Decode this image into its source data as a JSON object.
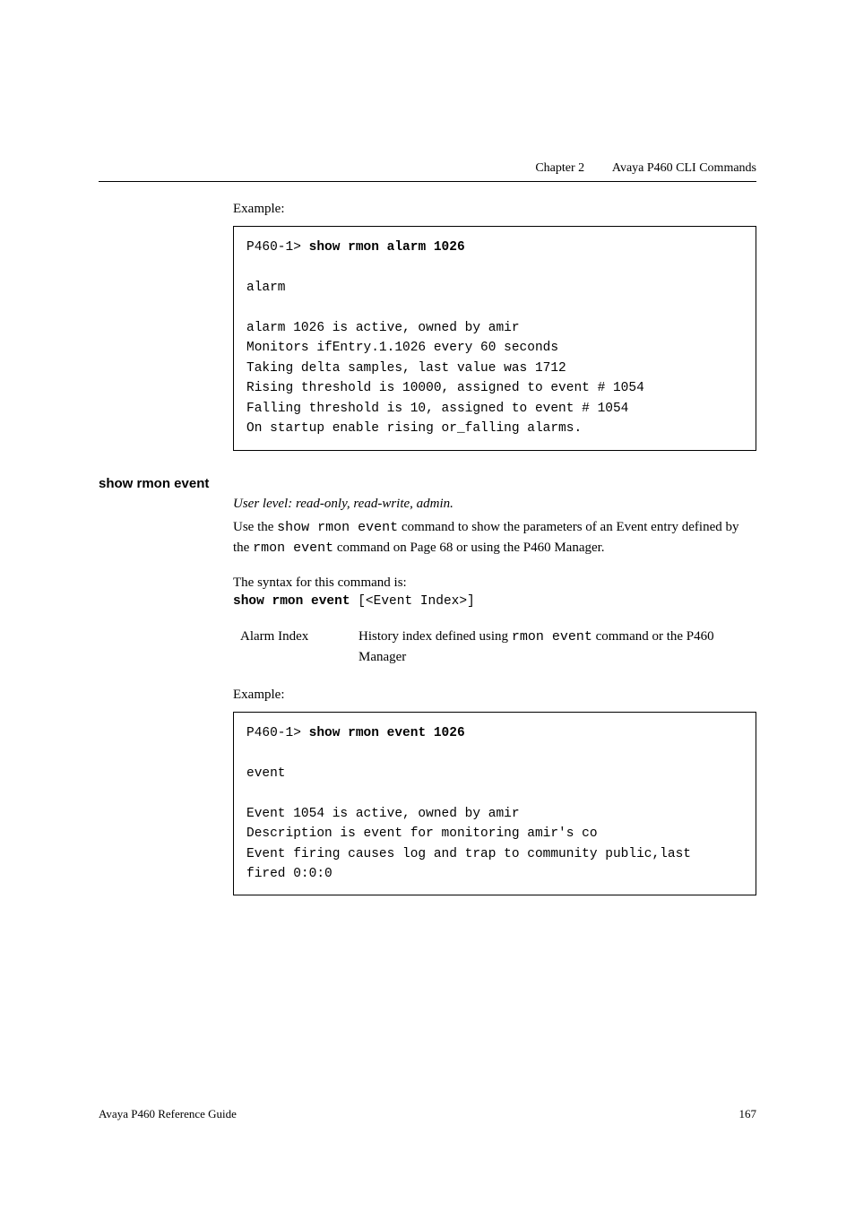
{
  "header": {
    "chapter": "Chapter 2",
    "title": "Avaya P460 CLI Commands"
  },
  "section1": {
    "example_label": "Example:",
    "code": {
      "prompt": "P460-1> ",
      "cmd": "show rmon alarm 1026",
      "blank1": "",
      "out1": "alarm",
      "blank2": "",
      "out2": "alarm 1026 is active, owned by amir",
      "out3": "Monitors ifEntry.1.1026 every 60 seconds",
      "out4": "Taking delta samples, last value was 1712",
      "out5": "Rising threshold is 10000, assigned to event # 1054",
      "out6": "Falling threshold is 10, assigned to event # 1054",
      "out7": "On startup enable rising or_falling alarms."
    }
  },
  "section2": {
    "heading": "show rmon event",
    "user_level": "User level: read-only, read-write, admin.",
    "desc_pre": "Use the ",
    "desc_cmd1": "show rmon event",
    "desc_mid": " command to show the parameters of an Event entry defined by the ",
    "desc_cmd2": "rmon event",
    "desc_post": " command on Page 68 or using the P460 Manager.",
    "syntax_label": "The syntax for this command is:",
    "syntax_bold": "show rmon event",
    "syntax_rest": " [<Event Index>]",
    "param_term": "Alarm Index",
    "param_def_pre": "History index defined using ",
    "param_def_cmd": "rmon event",
    "param_def_post": " command or the P460 Manager",
    "example_label": "Example:",
    "code": {
      "prompt": "P460-1> ",
      "cmd": "show rmon event 1026",
      "blank1": "",
      "out1": "event",
      "blank2": "",
      "out2": "Event 1054 is active, owned by amir",
      "out3": "Description is event for monitoring amir's co",
      "out4": "Event firing causes log and trap to community public,last",
      "out5": "fired 0:0:0"
    }
  },
  "footer": {
    "title": "Avaya P460 Reference Guide",
    "page": "167"
  }
}
